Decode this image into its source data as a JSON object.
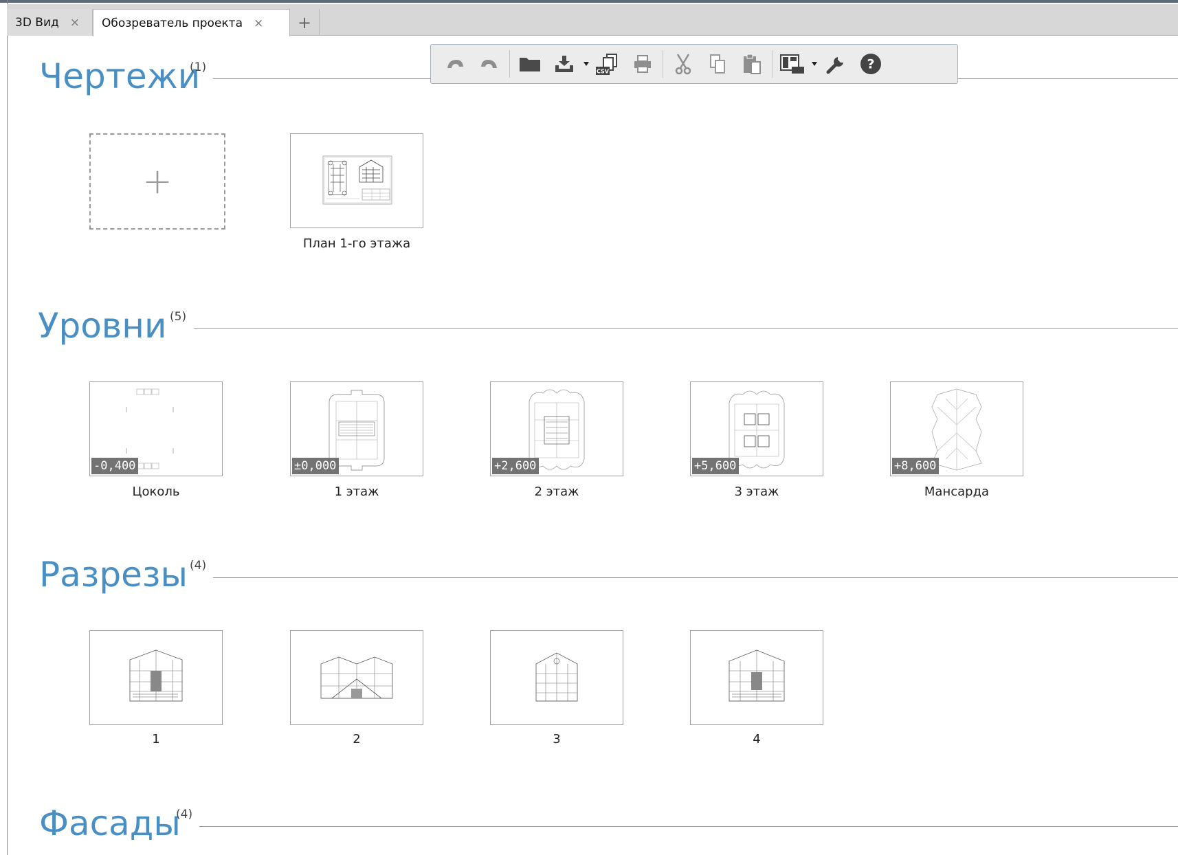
{
  "tabs": [
    {
      "label": "3D Вид",
      "close": "×"
    },
    {
      "label": "Обозреватель проекта",
      "close": "×"
    }
  ],
  "tab_add": "+",
  "toolbar": {
    "icons": [
      "undo-icon",
      "redo-icon",
      "open-folder-icon",
      "import-icon",
      "export-csv-icon",
      "print-icon",
      "cut-icon",
      "copy-icon",
      "paste-icon",
      "layout-icon",
      "settings-wrench-icon",
      "help-icon"
    ],
    "help_glyph": "?",
    "csv_label": "CSV"
  },
  "sections": {
    "drawings": {
      "title": "Чертежи",
      "count": "(1)",
      "add_glyph": "+",
      "items": [
        {
          "caption": "План 1-го этажа"
        }
      ]
    },
    "levels": {
      "title": "Уровни",
      "count": "(5)",
      "items": [
        {
          "caption": "Цоколь",
          "elevation": "-0,400"
        },
        {
          "caption": "1 этаж",
          "elevation": "±0,000"
        },
        {
          "caption": "2 этаж",
          "elevation": "+2,600"
        },
        {
          "caption": "3 этаж",
          "elevation": "+5,600"
        },
        {
          "caption": "Мансарда",
          "elevation": "+8,600"
        }
      ]
    },
    "sections": {
      "title": "Разрезы",
      "count": "(4)",
      "items": [
        {
          "caption": "1"
        },
        {
          "caption": "2"
        },
        {
          "caption": "3"
        },
        {
          "caption": "4"
        }
      ]
    },
    "facades": {
      "title": "Фасады",
      "count": "(4)"
    }
  },
  "colors": {
    "section_title": "#4a8fc3",
    "badge_bg": "#737373",
    "tab_bar": "#d7d7d7"
  }
}
